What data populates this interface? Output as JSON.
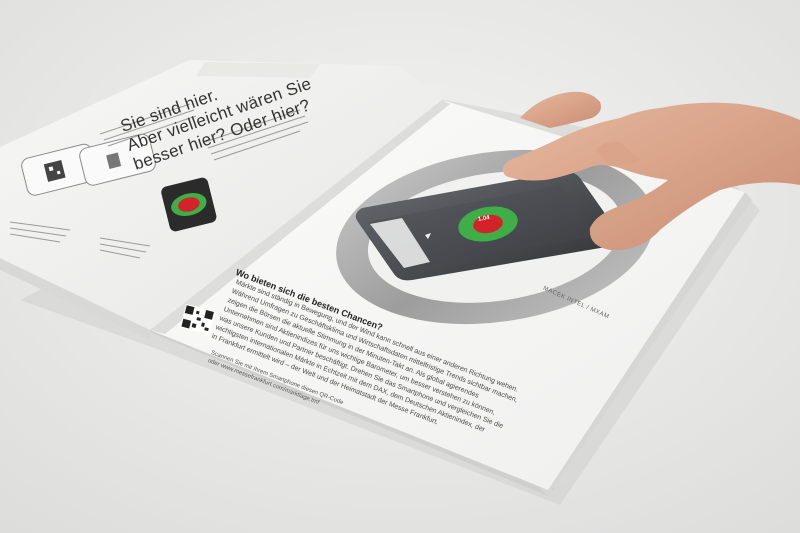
{
  "brochure": {
    "left_page": {
      "headline_lines": [
        "Sie sind hier.",
        "Aber vielleicht wären Sie",
        "besser hier? Oder hier?"
      ]
    },
    "right_page": {
      "subheadline": "Wo bieten sich die besten Chancen?",
      "body_lines": [
        "Märkte sind ständig in Bewegung, und der Wind kann schnell aus einer anderen Richtung wehen.",
        "Während Umfragen zu Geschäftsklima und Wirtschaftsdaten mittelfristige Trends sichtbar machen,",
        "zeigen die Börsen die aktuelle Stimmung in der Minuten-Takt an. Als global agierendes",
        "Unternehmen sind Aktienindizes für uns wichtige Barometer, um besser verstehen zu können,",
        "was unsere Kunden und Partner beschäftigt. Drehen Sie das Smartphone und vergleichen Sie die",
        "wichtigsten internationalen Märkte in Echtzeit mit dem DAX, dem Deutschen Aktienindex, der",
        "in Frankfurt ermittelt wird – der Welt und der Heimatstadt der Messe Frankfurt."
      ],
      "qr_caption_lines": [
        "Scannen Sie mit Ihrem Smartphone diesen QR-Code",
        "oder www.messefrankfurt.com/marktlage.tmf"
      ],
      "ring_label": "MACEK INTEL / MXAM"
    },
    "phone_screen": {
      "value_label": "1.04",
      "accent_green": "#3fae49",
      "accent_red": "#d3232a"
    }
  }
}
